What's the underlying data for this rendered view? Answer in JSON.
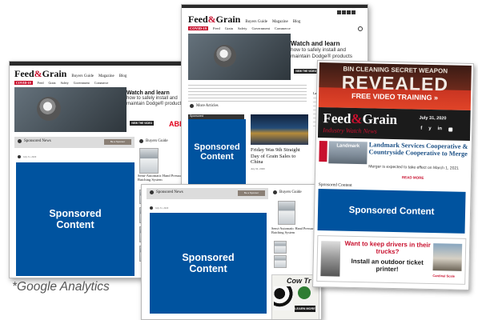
{
  "brand": {
    "logo_left": "Feed",
    "logo_amp": "&",
    "logo_right": "Grain"
  },
  "nav": {
    "items": [
      "Buyers Guide",
      "Magazine",
      "Blog"
    ],
    "covid": "COVID-19",
    "cats": [
      "Feed",
      "Grain",
      "Safety",
      "Government",
      "Commerce"
    ]
  },
  "ad": {
    "title": "Watch and learn",
    "body": "how to safely install and maintain Dodge® products",
    "cta": "VIEW THE VIDEO",
    "brand": "ABB"
  },
  "sections": {
    "sponsored_news": "Sponsored News",
    "buyers_guide": "Buyers Guide",
    "more_articles": "More Articles",
    "sponsored": "Sponsored",
    "sponsored_content": "Sponsored Content",
    "be_sponsor": "Be a Sponsor"
  },
  "products": {
    "mixer": "Semi-Automatic Hand Pressure Batching System"
  },
  "article": {
    "headline": "Friday Was 9th Straight Day of Grain Sales to China",
    "date": "July 31, 2020"
  },
  "newsletter": {
    "banner_line1": "BIN CLEANING SECRET WEAPON",
    "banner_line2": "REVEALED",
    "banner_line3": "FREE VIDEO TRAINING »",
    "subtitle": "Industry Watch News",
    "date": "July 31, 2020",
    "social": [
      "f",
      "y",
      "in",
      "rss"
    ],
    "story_title": "Landmark Services Cooperative & Countryside Cooperative to Merge",
    "story_body": "Merger is expected to take effect on March 1, 2021",
    "read_more": "READ MORE",
    "sponsored_label": "Sponsored Content",
    "sponsored_block": "Sponsored Content",
    "bottom_ad_q": "Want to keep drivers in their trucks?",
    "bottom_ad_a": "Install an outdoor ticket printer!",
    "bottom_ad_brand": "Cardinal Scale"
  },
  "cow_ad": {
    "brand": "Cow Tr",
    "cta": "LEARN MORE"
  },
  "caption": "*Google Analytics"
}
